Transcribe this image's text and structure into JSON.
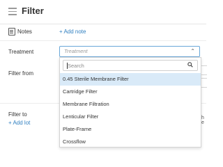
{
  "header": {
    "title": "Filter"
  },
  "notes": {
    "label": "Notes",
    "add_label": "+ Add note"
  },
  "treatment": {
    "label": "Treatment",
    "placeholder": "Treatment",
    "search_placeholder": "Search",
    "options": [
      {
        "label": "0.45 Sterile Membrane Filter",
        "highlighted": true
      },
      {
        "label": "Cartridge Filter"
      },
      {
        "label": "Membrane Filtration"
      },
      {
        "label": "Lenticular Filter"
      },
      {
        "label": "Plate-Frame"
      },
      {
        "label": "Crossflow"
      }
    ]
  },
  "filter_from": {
    "label": "Filter from"
  },
  "filter_to": {
    "label": "Filter to",
    "add_lot_label": "+ Add lot"
  },
  "clipped_right_text": "h e"
}
